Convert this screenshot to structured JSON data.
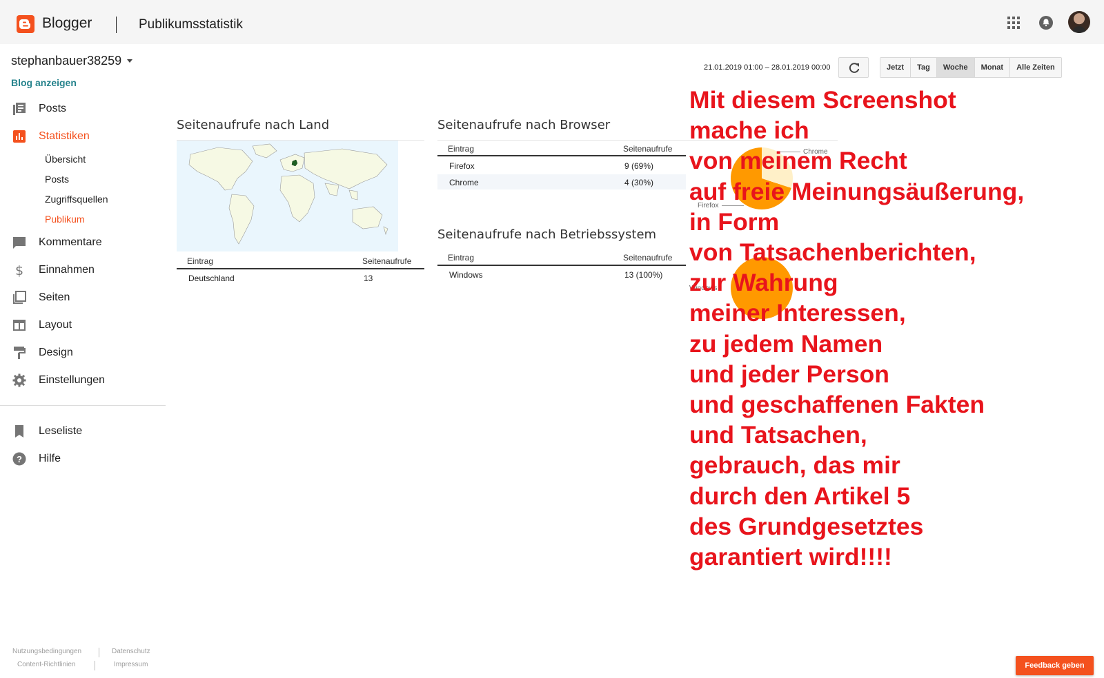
{
  "header": {
    "brand": "Blogger",
    "page_title": "Publikumsstatistik"
  },
  "sidebar": {
    "blog_name": "stephanbauer38259",
    "view_blog": "Blog anzeigen",
    "items": [
      {
        "label": "Posts",
        "icon": "posts-icon"
      },
      {
        "label": "Statistiken",
        "icon": "stats-icon",
        "active": true
      },
      {
        "label": "Kommentare",
        "icon": "comments-icon"
      },
      {
        "label": "Einnahmen",
        "icon": "earnings-icon"
      },
      {
        "label": "Seiten",
        "icon": "pages-icon"
      },
      {
        "label": "Layout",
        "icon": "layout-icon"
      },
      {
        "label": "Design",
        "icon": "design-icon"
      },
      {
        "label": "Einstellungen",
        "icon": "settings-icon"
      }
    ],
    "sub_items": [
      {
        "label": "Übersicht"
      },
      {
        "label": "Posts"
      },
      {
        "label": "Zugriffsquellen"
      },
      {
        "label": "Publikum",
        "active": true
      }
    ],
    "secondary": [
      {
        "label": "Leseliste",
        "icon": "bookmark-icon"
      },
      {
        "label": "Hilfe",
        "icon": "help-icon"
      }
    ],
    "footer": {
      "terms": "Nutzungsbedingungen",
      "privacy": "Datenschutz",
      "content_policy": "Content-Richtlinien",
      "imprint": "Impressum"
    }
  },
  "toolbar": {
    "range": "21.01.2019 01:00 – 28.01.2019 00:00",
    "buttons": [
      "Jetzt",
      "Tag",
      "Woche",
      "Monat",
      "Alle Zeiten"
    ],
    "active": "Woche"
  },
  "sections": {
    "country": {
      "title": "Seitenaufrufe nach Land",
      "col1": "Eintrag",
      "col2": "Seitenaufrufe",
      "rows": [
        {
          "entry": "Deutschland",
          "views": "13"
        }
      ]
    },
    "browser": {
      "title": "Seitenaufrufe nach Browser",
      "col1": "Eintrag",
      "col2": "Seitenaufrufe",
      "rows": [
        {
          "entry": "Firefox",
          "views": "9 (69%)"
        },
        {
          "entry": "Chrome",
          "views": "4 (30%)"
        }
      ],
      "pie_labels": {
        "chrome": "Chrome",
        "firefox": "Firefox"
      }
    },
    "os": {
      "title": "Seitenaufrufe nach Betriebssystem",
      "col1": "Eintrag",
      "col2": "Seitenaufrufe",
      "rows": [
        {
          "entry": "Windows",
          "views": "13 (100%)"
        }
      ],
      "pie_labels": {
        "windows": "Windows"
      }
    }
  },
  "overlay_text": [
    "Mit diesem Screenshot",
    "mache ich",
    "von meinem Recht",
    "auf freie Meinungsäußerung,",
    "in Form",
    "von Tatsachenberichten,",
    "zur Wahrung",
    "meiner Interessen,",
    "zu jedem Namen",
    "und jeder Person",
    "und geschaffenen Fakten",
    "und Tatsachen,",
    "gebrauch, das mir",
    "durch den Artikel 5",
    "des Grundgesetztes",
    "garantiert wird!!!!"
  ],
  "feedback_label": "Feedback geben",
  "colors": {
    "accent": "#f4511e",
    "link": "#26838c",
    "overlay": "#e8141c",
    "pie": "#ff9900"
  }
}
